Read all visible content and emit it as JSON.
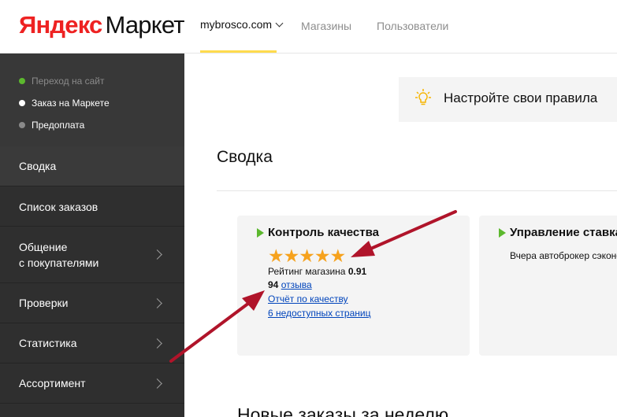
{
  "header": {
    "logo_brand": "Яндекс",
    "logo_product": "Маркет",
    "nav": [
      {
        "label": "mybrosco.com"
      },
      {
        "label": "Магазины"
      },
      {
        "label": "Пользователи"
      }
    ]
  },
  "sidebar": {
    "statuses": [
      {
        "label": "Переход на сайт",
        "color": "#5cb82e"
      },
      {
        "label": "Заказ на Маркете",
        "color": "#ffffff"
      },
      {
        "label": "Предоплата",
        "color": "#8a8a8a"
      }
    ],
    "menu": [
      {
        "label": "Сводка"
      },
      {
        "label": "Список заказов"
      },
      {
        "label": "Общение",
        "label2": "с покупателями"
      },
      {
        "label": "Проверки"
      },
      {
        "label": "Статистика"
      },
      {
        "label": "Ассортимент"
      }
    ]
  },
  "banner": {
    "text": "Настройте свои правила"
  },
  "main": {
    "title": "Сводка",
    "bottom_title": "Новые заказы за неделю"
  },
  "quality_card": {
    "title": "Контроль качества",
    "stars": "★★★★★",
    "rating_label": "Рейтинг магазина",
    "rating_value": "0.91",
    "reviews_count": "94",
    "reviews_link": "отзыва",
    "quality_report_link": "Отчёт по качеству",
    "unavailable_pages_link": "6 недоступных страниц"
  },
  "broker_card": {
    "title": "Управление ставками",
    "text": "Вчера автоброкер сэкономил"
  },
  "colors": {
    "accent_yellow": "#ffdb4d",
    "star_orange": "#f6a21d",
    "link_blue": "#0044bb",
    "annotation_arrow": "#b0142a"
  }
}
